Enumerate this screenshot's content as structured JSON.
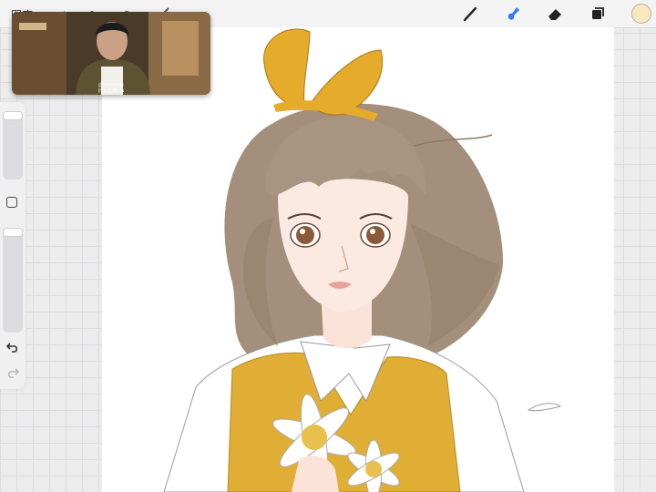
{
  "topbar": {
    "gallery_label": "图库",
    "tools": [
      {
        "name": "brush-icon",
        "active": false
      },
      {
        "name": "smudge-icon",
        "active": true
      },
      {
        "name": "eraser-icon",
        "active": false
      },
      {
        "name": "layers-icon",
        "active": false
      }
    ],
    "active_color": "#f6e9bf",
    "accent_color": "#2f7cf6"
  },
  "sidebar": {
    "undo_icon": "undo-icon",
    "redo_icon": "redo-icon",
    "modify_icon": "square-icon",
    "brush_size": 0.1,
    "opacity": 0.0
  },
  "video": {
    "subtitle_line1": "这一·一·一件",
    "subtitle_line2": "(h a e) Mr Lu"
  },
  "canvas": {
    "artwork": "illustration of a girl with brown bob hair, yellow ribbon, yellow vest and daisies"
  }
}
